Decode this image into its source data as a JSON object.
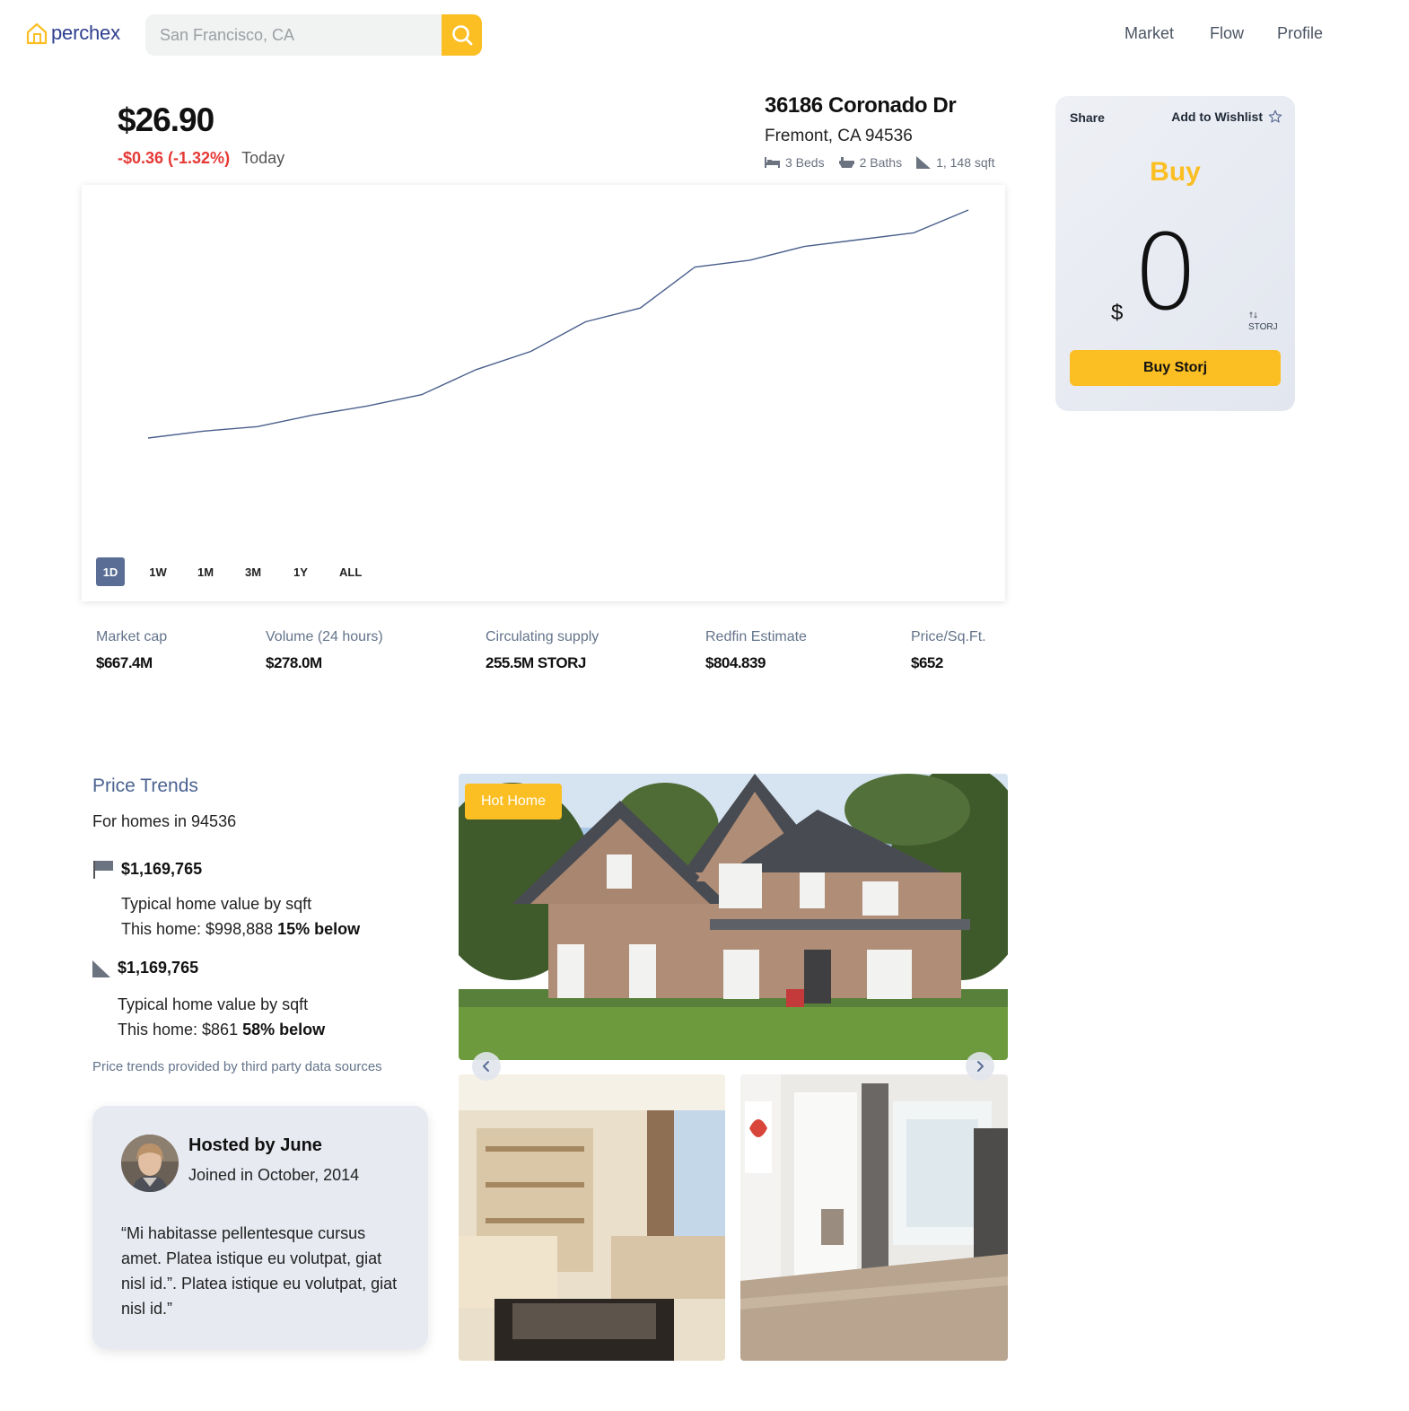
{
  "brand": {
    "name": "perchex",
    "accent": "#fbbf24",
    "primary": "#2f3f8f"
  },
  "search": {
    "placeholder": "San Francisco, CA",
    "value": ""
  },
  "nav": {
    "items": [
      "Market",
      "Flow",
      "Profile"
    ]
  },
  "quote": {
    "price": "$26.90",
    "change": "-$0.36 (-1.32%)",
    "period": "Today"
  },
  "property": {
    "street": "36186 Coronado Dr",
    "city": "Fremont, CA 94536",
    "beds": "3 Beds",
    "baths": "2 Baths",
    "sqft": "1, 148 sqft"
  },
  "chart_data": {
    "type": "line",
    "title": "",
    "xlabel": "",
    "ylabel": "",
    "grid": false,
    "color": "#4a5f8c",
    "series": [
      {
        "values": [
          0.0,
          0.03,
          0.05,
          0.1,
          0.14,
          0.19,
          0.3,
          0.38,
          0.51,
          0.57,
          0.75,
          0.78,
          0.84,
          0.87,
          0.9,
          1.0
        ]
      }
    ],
    "ylim": [
      0,
      1
    ]
  },
  "ranges": [
    "1D",
    "1W",
    "1M",
    "3M",
    "1Y",
    "ALL"
  ],
  "active_range": "1D",
  "stats": [
    {
      "label": "Market cap",
      "value": "$667.4M"
    },
    {
      "label": "Volume (24 hours)",
      "value": "$278.0M"
    },
    {
      "label": "Circulating supply",
      "value": "255.5M STORJ"
    },
    {
      "label": "Redfin Estimate",
      "value": "$804.839"
    },
    {
      "label": "Price/Sq.Ft.",
      "value": "$652"
    }
  ],
  "buy_panel": {
    "share_label": "Share",
    "wishlist_label": "Add to Wishlist",
    "title": "Buy",
    "currency": "$",
    "amount": "0",
    "unit": "STORJ",
    "button_label": "Buy Storj"
  },
  "trends": {
    "title": "Price Trends",
    "subtitle": "For homes in 94536",
    "items": [
      {
        "value": "$1,169,765",
        "desc": "Typical home value by sqft",
        "this_home": "This home: $998,888",
        "diff": "15% below",
        "icon": "flag-icon"
      },
      {
        "value": "$1,169,765",
        "desc": "Typical home value by sqft",
        "this_home": "This home: $861",
        "diff": "58% below",
        "icon": "area-icon"
      }
    ],
    "note": "Price trends provided by third party data sources"
  },
  "host": {
    "name": "Hosted by June",
    "joined": "Joined in October, 2014",
    "quote": "“Mi habitasse pellentesque cursus amet. Platea istique eu volutpat, giat nisl id.”. Platea istique eu volutpat, giat nisl id.”"
  },
  "gallery": {
    "badge": "Hot Home",
    "icons": [
      "chevron-left-icon",
      "chevron-right-icon"
    ]
  }
}
